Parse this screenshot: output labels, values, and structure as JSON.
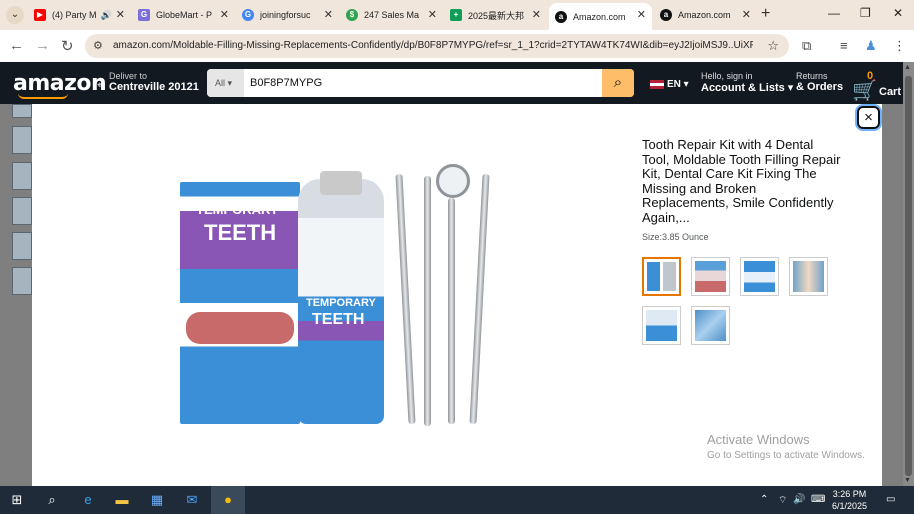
{
  "browser": {
    "tabs": [
      {
        "title": "(4) Party M",
        "icon": "youtube-icon",
        "color": "#ff0000",
        "active": false,
        "audio": true
      },
      {
        "title": "GlobeMart - P",
        "icon": "globemart-icon",
        "color": "#7b6fd8",
        "active": false
      },
      {
        "title": "joiningforsuc",
        "icon": "google-icon",
        "color": "#4285f4",
        "active": false
      },
      {
        "title": "247 Sales Ma",
        "icon": "sales-icon",
        "color": "#2ea44f",
        "active": false
      },
      {
        "title": "2025最新大邦",
        "icon": "sheets-icon",
        "color": "#0f9d58",
        "active": false
      },
      {
        "title": "Amazon.com",
        "icon": "amazon-icon",
        "color": "#111111",
        "active": true
      },
      {
        "title": "Amazon.com",
        "icon": "amazon-icon",
        "color": "#111111",
        "active": false
      }
    ],
    "url": "amazon.com/Moldable-Filling-Missing-Replacements-Confidently/dp/B0F8P7MYPG/ref=sr_1_1?crid=2TYTAW4TK74WI&dib=eyJ2IjoiMSJ9..UiXP..."
  },
  "amazon": {
    "logo": "amazon",
    "deliver_line1": "Deliver to",
    "deliver_line2": "Centreville 20121",
    "search_category": "All",
    "search_query": "B0F8P7MYPG",
    "language": "EN",
    "account_line1": "Hello, sign in",
    "account_line2": "Account & Lists",
    "returns_line1": "Returns",
    "returns_line2": "& Orders",
    "cart_count": "0",
    "cart_label": "Cart"
  },
  "modal": {
    "close_label": "×",
    "title": "Tooth Repair Kit with 4 Dental Tool, Moldable Tooth Filling Repair Kit, Dental Care Kit Fixing The Missing and Broken Replacements, Smile Confidently Again,...",
    "size_label": "Size:3.85 Ounce",
    "product_image": {
      "box_text1": "TEMPORARY",
      "box_text2": "TEETH",
      "bottle_text1": "TEMPORARY",
      "bottle_text2": "TEETH"
    },
    "thumbnails": [
      "main",
      "before-after",
      "infographic",
      "lifestyle",
      "features",
      "usage"
    ]
  },
  "watermark": {
    "line1": "Activate Windows",
    "line2": "Go to Settings to activate Windows."
  },
  "taskbar": {
    "time": "3:26 PM",
    "date": "6/1/2025"
  }
}
